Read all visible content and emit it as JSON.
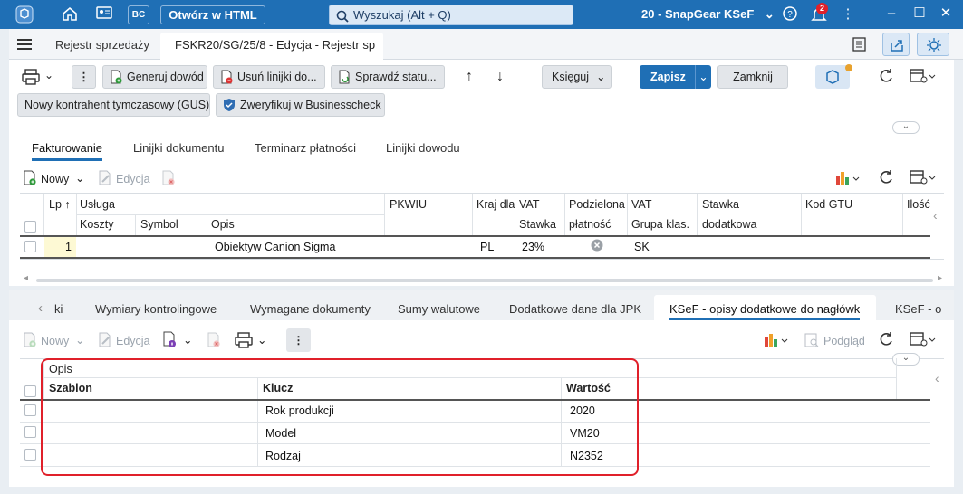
{
  "titlebar": {
    "open_html_label": "Otwórz w HTML",
    "search_placeholder": "Wyszukaj (Alt + Q)",
    "company": "20 - SnapGear KSeF",
    "notification_count": "2",
    "bc_label": "BC"
  },
  "tabs": {
    "tab1": "Rejestr sprzedaży",
    "tab2": "FSKR20/SG/25/8 - Edycja - Rejestr sp"
  },
  "toolbar": {
    "generate_proof": "Generuj dowód",
    "remove_proof_lines": "Usuń linijki do...",
    "check_status": "Sprawdź statu...",
    "post": "Księguj",
    "save": "Zapisz",
    "close": "Zamknij",
    "new_temp_contractor": "Nowy kontrahent tymczasowy (GUS)",
    "verify_businesscheck": "Zweryfikuj w Businesscheck"
  },
  "section_tabs": [
    "Fakturowanie",
    "Linijki dokumentu",
    "Terminarz płatności",
    "Linijki dowodu"
  ],
  "grid1": {
    "new_label": "Nowy",
    "edit_label": "Edycja",
    "headers_row1": [
      "Lp",
      "Usługa",
      "PKWIU",
      "Kraj dla",
      "VAT",
      "Podzielona",
      "VAT",
      "Stawka",
      "Kod GTU",
      "Ilość"
    ],
    "headers_row2": [
      "Koszty",
      "Symbol",
      "Opis",
      "Stawka",
      "płatność",
      "Grupa klas.",
      "dodatkowa"
    ],
    "row": {
      "lp": "1",
      "opis": "Obiektyw Canion Sigma",
      "kraj": "PL",
      "vat": "23%",
      "grupa": "SK"
    }
  },
  "bottom_tabs": [
    "ki",
    "Wymiary kontrolingowe",
    "Wymagane dokumenty",
    "Sumy walutowe",
    "Dodatkowe dane dla JPK",
    "KSeF - opisy dodatkowe do nagłówka",
    "KSeF - o"
  ],
  "grid2": {
    "new_label": "Nowy",
    "edit_label": "Edycja",
    "preview_label": "Podgląd",
    "group_header": "Opis",
    "headers": [
      "Szablon",
      "Klucz",
      "Wartość"
    ],
    "rows": [
      {
        "klucz": "Rok produkcji",
        "wartosc": "2020"
      },
      {
        "klucz": "Model",
        "wartosc": "VM20"
      },
      {
        "klucz": "Rodzaj",
        "wartosc": "N2352"
      }
    ]
  },
  "colors": {
    "titlebar": "#1f6fb5",
    "save_button": "#1f6fb5",
    "highlight": "#e0202a",
    "active_tab_underline": "#1f6fb5"
  }
}
